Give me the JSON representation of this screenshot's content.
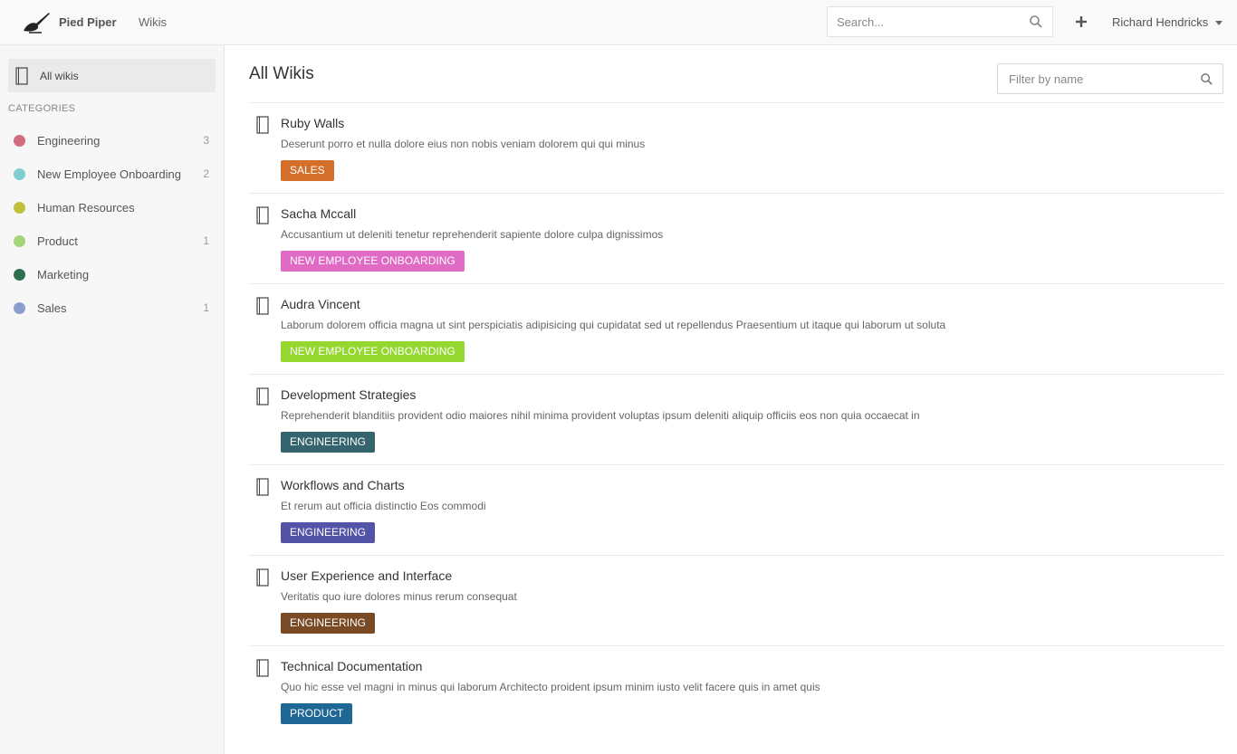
{
  "header": {
    "brand": "Pied Piper",
    "nav_wikis": "Wikis",
    "search_placeholder": "Search...",
    "user_name": "Richard Hendricks"
  },
  "sidebar": {
    "all_wikis_label": "All wikis",
    "categories_heading": "CATEGORIES",
    "categories": [
      {
        "name": "Engineering",
        "count": "3",
        "color": "#d16d7c"
      },
      {
        "name": "New Employee Onboarding",
        "count": "2",
        "color": "#7ecfcf"
      },
      {
        "name": "Human Resources",
        "count": "",
        "color": "#c0c03c"
      },
      {
        "name": "Product",
        "count": "1",
        "color": "#a6d47a"
      },
      {
        "name": "Marketing",
        "count": "",
        "color": "#2e6e4e"
      },
      {
        "name": "Sales",
        "count": "1",
        "color": "#8b9fcf"
      }
    ]
  },
  "main": {
    "title": "All Wikis",
    "filter_placeholder": "Filter by name",
    "wikis": [
      {
        "title": "Ruby Walls",
        "description": "Deserunt porro et nulla dolore eius non nobis veniam dolorem qui qui minus",
        "tag": "SALES",
        "tag_color": "#d36f2a"
      },
      {
        "title": "Sacha Mccall",
        "description": "Accusantium ut deleniti tenetur reprehenderit sapiente dolore culpa dignissimos",
        "tag": "NEW EMPLOYEE ONBOARDING",
        "tag_color": "#e06ac4"
      },
      {
        "title": "Audra Vincent",
        "description": "Laborum dolorem officia magna ut sint perspiciatis adipisicing qui cupidatat sed ut repellendus Praesentium ut itaque qui laborum ut soluta",
        "tag": "NEW EMPLOYEE ONBOARDING",
        "tag_color": "#93d72f"
      },
      {
        "title": "Development Strategies",
        "description": "Reprehenderit blanditiis provident odio maiores nihil minima provident voluptas ipsum deleniti aliquip officiis eos non quia occaecat in",
        "tag": "ENGINEERING",
        "tag_color": "#34656f"
      },
      {
        "title": "Workflows and Charts",
        "description": "Et rerum aut officia distinctio Eos commodi",
        "tag": "ENGINEERING",
        "tag_color": "#5354a8"
      },
      {
        "title": "User Experience and Interface",
        "description": "Veritatis quo iure dolores minus rerum consequat",
        "tag": "ENGINEERING",
        "tag_color": "#7a4a25"
      },
      {
        "title": "Technical Documentation",
        "description": "Quo hic esse vel magni in minus qui laborum Architecto proident ipsum minim iusto velit facere quis in amet quis",
        "tag": "PRODUCT",
        "tag_color": "#1f6896"
      }
    ]
  }
}
